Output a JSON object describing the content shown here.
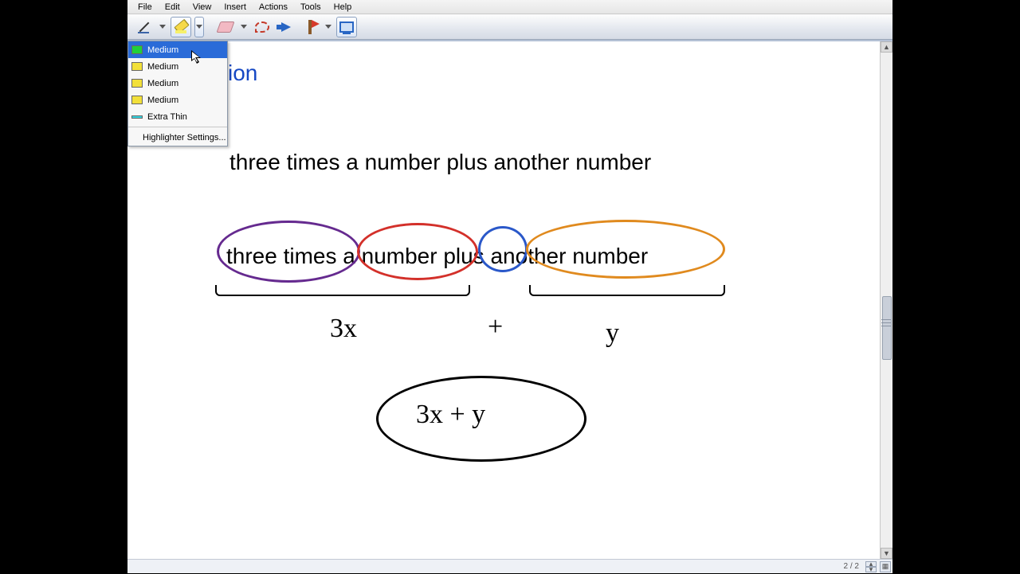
{
  "menu": {
    "items": [
      "File",
      "Edit",
      "View",
      "Insert",
      "Actions",
      "Tools",
      "Help"
    ]
  },
  "toolbar": {
    "pen": "pen-tool",
    "highlighter": "highlighter-tool",
    "eraser": "eraser-tool",
    "lasso": "lasso-select",
    "arrow": "insert-arrow",
    "flag": "bookmark-flag",
    "fullscreen": "fullscreen-toggle"
  },
  "highlighter_menu": {
    "items": [
      {
        "label": "Medium",
        "swatch": "#20d03a",
        "selected": true
      },
      {
        "label": "Medium",
        "swatch": "#f2e03a",
        "selected": false
      },
      {
        "label": "Medium",
        "swatch": "#f2e03a",
        "selected": false
      },
      {
        "label": "Medium",
        "swatch": "#f2e03a",
        "selected": false
      },
      {
        "label": "Extra Thin",
        "swatch": "#33d6e2",
        "selected": false
      }
    ],
    "settings_label": "Highlighter Settings..."
  },
  "canvas": {
    "title_fragment": "ion",
    "sentence": "three times a number plus another number",
    "circled_sentence": "three times a number plus another number",
    "term_3x": "3x",
    "term_plus": "+",
    "term_y": "y",
    "final": "3x + y"
  },
  "status": {
    "page": "2 / 2"
  }
}
